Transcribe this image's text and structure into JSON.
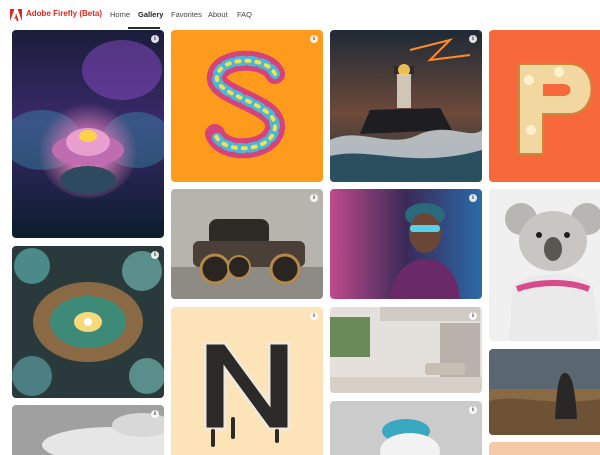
{
  "app": {
    "brand": "Adobe Firefly (Beta)"
  },
  "nav": [
    {
      "label": "Home"
    },
    {
      "label": "Gallery"
    },
    {
      "label": "Favorites"
    },
    {
      "label": "About"
    },
    {
      "label": "FAQ"
    }
  ],
  "info_glyph": "i",
  "colors": {
    "brand": "#e1251b"
  }
}
